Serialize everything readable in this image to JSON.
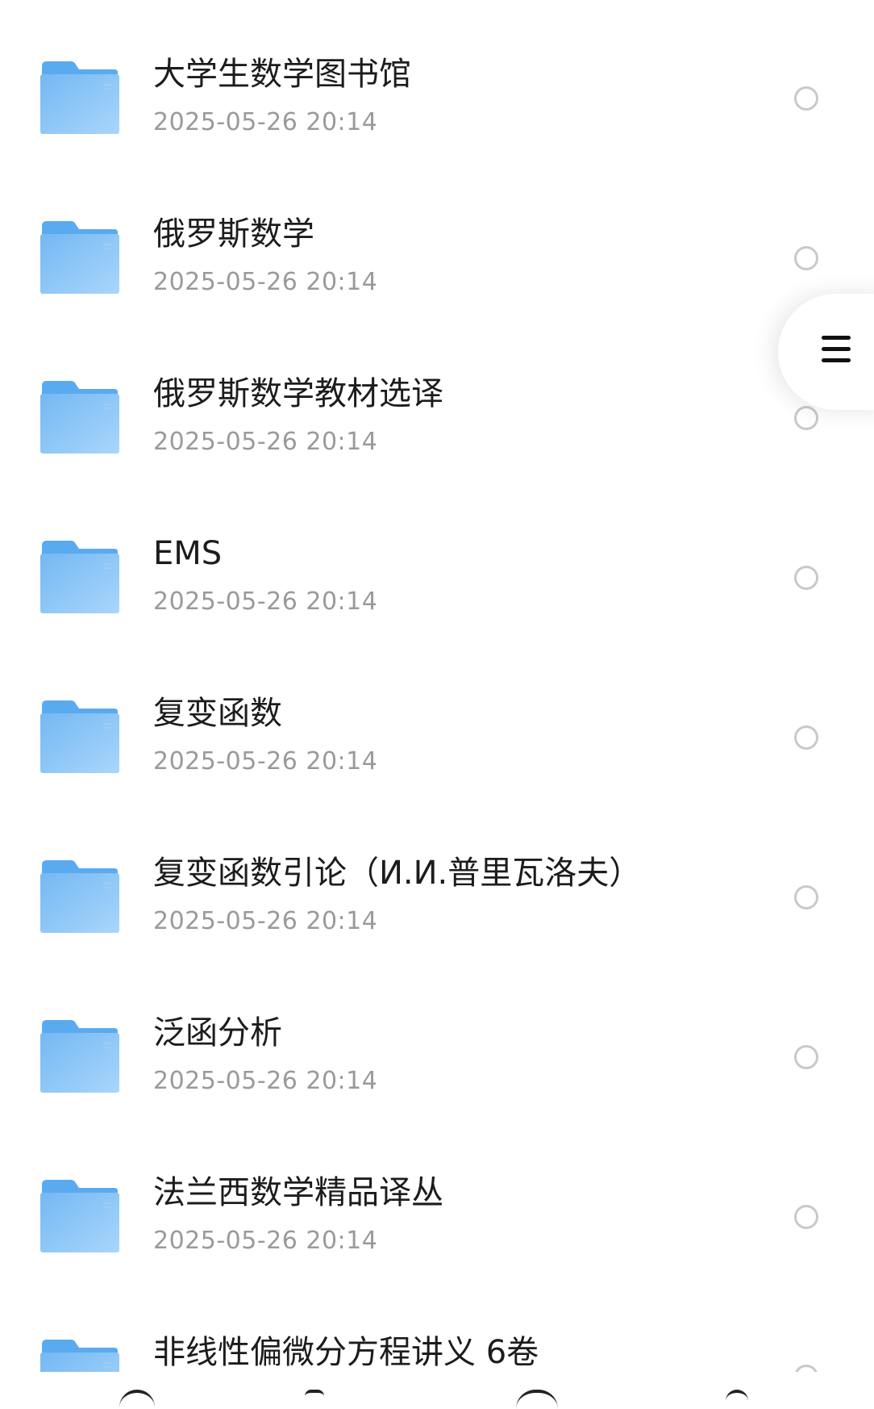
{
  "files": [
    {
      "name": "大学生数学图书馆",
      "date": "2025-05-26 20:14"
    },
    {
      "name": "俄罗斯数学",
      "date": "2025-05-26 20:14"
    },
    {
      "name": "俄罗斯数学教材选译",
      "date": "2025-05-26 20:14"
    },
    {
      "name": "EMS",
      "date": "2025-05-26 20:14"
    },
    {
      "name": "复变函数",
      "date": "2025-05-26 20:14"
    },
    {
      "name": "复变函数引论（И.И.普里瓦洛夫）",
      "date": "2025-05-26 20:14"
    },
    {
      "name": "泛函分析",
      "date": "2025-05-26 20:14"
    },
    {
      "name": "法兰西数学精品译丛",
      "date": "2025-05-26 20:14"
    },
    {
      "name": "非线性偏微分方程讲义 6卷",
      "date": ""
    }
  ],
  "icons": {
    "folder": "folder-icon",
    "select": "radio-circle",
    "menu": "hamburger-icon"
  },
  "colors": {
    "folder_front": "#8cc6f6",
    "folder_back": "#5aaaf0",
    "radio_border": "#c9c9c9",
    "date_text": "#9a9a9a"
  }
}
